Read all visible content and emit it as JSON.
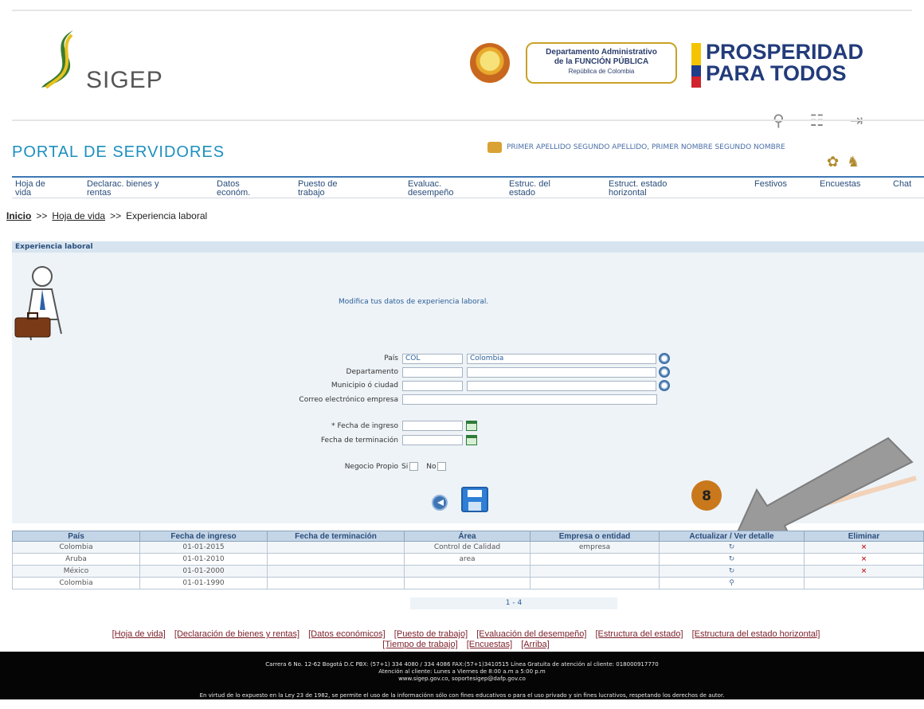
{
  "header": {
    "logo_text": "SIGEP",
    "dafp_line1": "Departamento Administrativo",
    "dafp_line2": "de la FUNCIÓN PÚBLICA",
    "dafp_line3": "República de Colombia",
    "prosperidad_line1": "PROSPERIDAD",
    "prosperidad_line2": "PARA TODOS",
    "flag_colors": [
      "#f5c400",
      "#1f3d8a",
      "#d0232c"
    ],
    "icons": [
      "search-icon",
      "sitemap-icon",
      "logout-icon"
    ]
  },
  "portal": {
    "title": "PORTAL DE SERVIDORES",
    "user_name": "PRIMER APELLIDO SEGUNDO APELLIDO, PRIMER NOMBRE SEGUNDO NOMBRE"
  },
  "nav": {
    "items": [
      {
        "line1": "Hoja de",
        "line2": "vida"
      },
      {
        "line1": "Declarac. bienes y",
        "line2": "rentas"
      },
      {
        "line1": "Datos",
        "line2": "económ."
      },
      {
        "line1": "Puesto de",
        "line2": "trabajo"
      },
      {
        "line1": "Evaluac.",
        "line2": "desempeño"
      },
      {
        "line1": "Estruc. del",
        "line2": "estado"
      },
      {
        "line1": "Estruct. estado",
        "line2": "horizontal"
      },
      {
        "line1": "Festivos",
        "line2": ""
      },
      {
        "line1": "Encuestas",
        "line2": ""
      },
      {
        "line1": "Chat",
        "line2": ""
      }
    ]
  },
  "breadcrumb": {
    "home": "Inicio",
    "sep": ">>",
    "section": "Hoja de vida",
    "current": "Experiencia laboral"
  },
  "panel": {
    "header": "Experiencia laboral",
    "message": "Modifica tus datos de experiencia laboral."
  },
  "form": {
    "pais_label": "País",
    "pais_code": "COL",
    "pais_name": "Colombia",
    "departamento_label": "Departamento",
    "municipio_label": "Municipio ó ciudad",
    "correo_label": "Correo electrónico empresa",
    "fecha_ingreso_label": "* Fecha de ingreso",
    "fecha_terminacion_label": "Fecha de terminación",
    "negocio_label": "Negocio Propio",
    "si_label": "Si",
    "no_label": "No"
  },
  "annotation": {
    "badge": "8",
    "arrow_color": "#9a9a9a"
  },
  "table": {
    "headers": [
      "País",
      "Fecha de ingreso",
      "Fecha de terminación",
      "Área",
      "Empresa o entidad",
      "Actualizar / Ver detalle",
      "Eliminar"
    ],
    "rows": [
      {
        "pais": "Colombia",
        "ingreso": "01-01-2015",
        "terminacion": "",
        "area": "Control de Calidad",
        "empresa": "empresa",
        "action": "↻",
        "eliminar": "×"
      },
      {
        "pais": "Aruba",
        "ingreso": "01-01-2010",
        "terminacion": "",
        "area": "area",
        "empresa": "",
        "action": "↻",
        "eliminar": "×"
      },
      {
        "pais": "México",
        "ingreso": "01-01-2000",
        "terminacion": "",
        "area": "",
        "empresa": "",
        "action": "↻",
        "eliminar": "×"
      },
      {
        "pais": "Colombia",
        "ingreso": "01-01-1990",
        "terminacion": "",
        "area": "",
        "empresa": "",
        "action": "⚲",
        "eliminar": ""
      }
    ],
    "pager": "1 - 4"
  },
  "footer_links": {
    "items": [
      "[Hoja de vida]",
      "[Declaración de bienes y rentas]",
      "[Datos económicos]",
      "[Puesto de trabajo]",
      "[Evaluación del desempeño]",
      "[Estructura del estado]",
      "[Estructura del estado horizontal]",
      "[Tiempo de trabajo]",
      "[Encuestas]",
      "[Arriba]"
    ]
  },
  "footer": {
    "line1": "Carrera 6 No. 12-62 Bogotá D.C PBX: (57+1) 334 4080 / 334 4086 FAX:(57+1)3410515 Línea Gratuita de atención al cliente: 018000917770",
    "line2": "Atención al cliente: Lunes a Viernes de 8:00 a.m a 5:00 p.m",
    "line3": "www.sigep.gov.co, soportesigep@dafp.gov.co",
    "line4": "En virtud de lo expuesto en la Ley 23 de 1982, se permite el uso de la informaciónn sólo con fines educativos o para el uso privado y sin fines lucrativos, respetando los derechos de autor."
  }
}
